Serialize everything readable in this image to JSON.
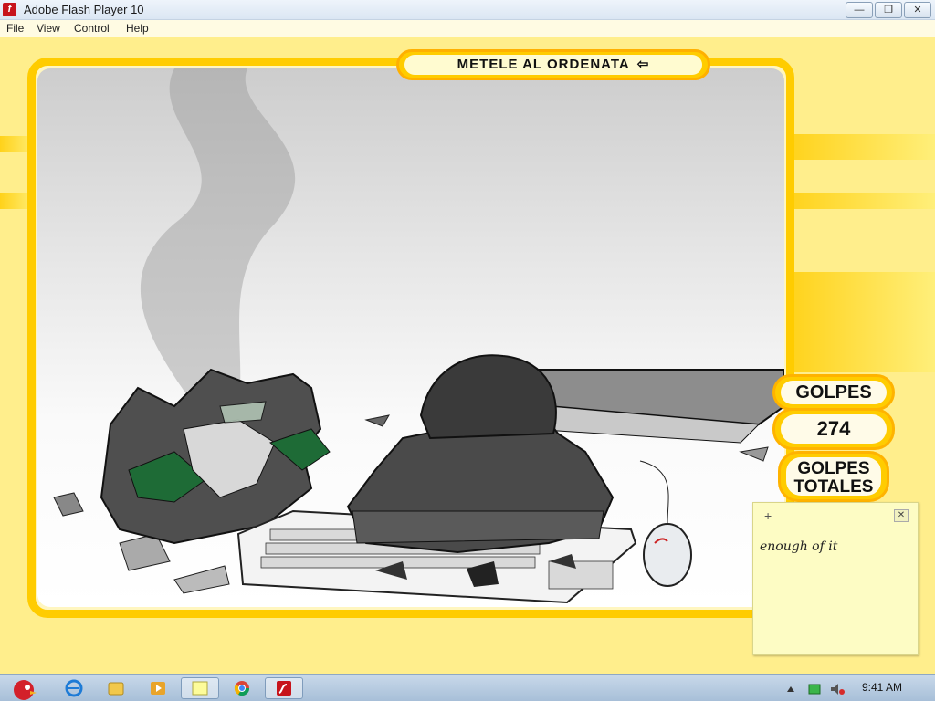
{
  "window": {
    "title": "Adobe Flash Player 10",
    "icon_letter": "f",
    "controls": {
      "minimize": "—",
      "restore": "❐",
      "close": "✕"
    }
  },
  "menu": {
    "items": [
      "File",
      "View",
      "Control",
      "Help"
    ]
  },
  "game": {
    "banner": "METELE AL ORDENATA",
    "banner_icon": "⇦",
    "golpes_label": "GOLPES",
    "golpes_value": "274",
    "golpes_totales_label": "GOLPES TOTALES"
  },
  "sticky_note": {
    "add_glyph": "+",
    "close_glyph": "✕",
    "text": "enough of it"
  },
  "taskbar": {
    "clock": "9:41 AM",
    "apps": [
      "start-button",
      "ie-icon",
      "explorer-icon",
      "media-player-icon",
      "sticky-notes-icon",
      "chrome-icon",
      "flash-icon"
    ]
  },
  "colors": {
    "accent": "#ffcc00",
    "background": "#ffee8c"
  }
}
